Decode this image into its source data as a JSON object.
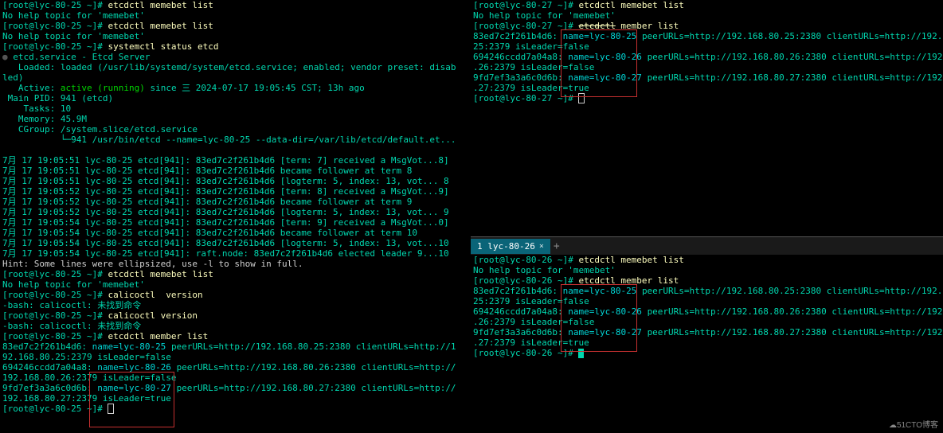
{
  "tabs": {
    "br_label": "1 lyc-80-26"
  },
  "left": {
    "l01_prompt": "[root@lyc-80-25 ~]# ",
    "l01_cmd": "etcdctl memebet list",
    "l02": "No help topic for 'memebet'",
    "l03_prompt": "[root@lyc-80-25 ~]# ",
    "l03_cmd": "etcdctl memebet list",
    "l04": "No help topic for 'memebet'",
    "l05_prompt": "[root@lyc-80-25 ~]# ",
    "l05_cmd": "systemctl status etcd",
    "l06a": "● ",
    "l06b": "etcd.service - Etcd Server",
    "l07": "   Loaded: loaded (/usr/lib/systemd/system/etcd.service; enabled; vendor preset: disab",
    "l07b": "led)",
    "l08a": "   Active: ",
    "l08b": "active (running)",
    "l08c": " since 三 2024-07-17 19:05:45 CST; 13h ago",
    "l09": " Main PID: 941 (etcd)",
    "l10": "    Tasks: 10",
    "l11": "   Memory: 45.9M",
    "l12": "   CGroup: /system.slice/etcd.service",
    "l13": "           └─941 /usr/bin/etcd --name=lyc-80-25 --data-dir=/var/lib/etcd/default.et...",
    "blank1": "",
    "l14": "7月 17 19:05:51 lyc-80-25 etcd[941]: 83ed7c2f261b4d6 [term: 7] received a MsgVot...8]",
    "l15": "7月 17 19:05:51 lyc-80-25 etcd[941]: 83ed7c2f261b4d6 became follower at term 8",
    "l16": "7月 17 19:05:51 lyc-80-25 etcd[941]: 83ed7c2f261b4d6 [logterm: 5, index: 13, vot... 8",
    "l17": "7月 17 19:05:52 lyc-80-25 etcd[941]: 83ed7c2f261b4d6 [term: 8] received a MsgVot...9]",
    "l18": "7月 17 19:05:52 lyc-80-25 etcd[941]: 83ed7c2f261b4d6 became follower at term 9",
    "l19": "7月 17 19:05:52 lyc-80-25 etcd[941]: 83ed7c2f261b4d6 [logterm: 5, index: 13, vot... 9",
    "l20": "7月 17 19:05:54 lyc-80-25 etcd[941]: 83ed7c2f261b4d6 [term: 9] received a MsgVot...0]",
    "l21": "7月 17 19:05:54 lyc-80-25 etcd[941]: 83ed7c2f261b4d6 became follower at term 10",
    "l22": "7月 17 19:05:54 lyc-80-25 etcd[941]: 83ed7c2f261b4d6 [logterm: 5, index: 13, vot...10",
    "l23": "7月 17 19:05:54 lyc-80-25 etcd[941]: raft.node: 83ed7c2f261b4d6 elected leader 9...10",
    "l24": "Hint: Some lines were ellipsized, use -l to show in full.",
    "l25_prompt": "[root@lyc-80-25 ~]# ",
    "l25_cmd": "etcdctl memebet list",
    "l26": "No help topic for 'memebet'",
    "l27_prompt": "[root@lyc-80-25 ~]# ",
    "l27_cmd": "calicoctl  version",
    "l28": "-bash: calicoctl: 未找到命令",
    "l29_prompt": "[root@lyc-80-25 ~]# ",
    "l29_cmd": "calicoctl version",
    "l30": "-bash: calicoctl: 未找到命令",
    "l31_prompt": "[root@lyc-80-25 ~]# ",
    "l31_cmd": "etcdctl member list",
    "l32a": "83ed7c2f261b4d6: ",
    "l32b": "name=lyc-80-25 ",
    "l32c": "peerURLs=http://192.168.80.25:2380 clientURLs=http://1",
    "l33a": "92.168.80.25:2379",
    "l33b": " isLeader=false",
    "l34a": "694246ccdd7a04a8: ",
    "l34b": "name=lyc-80-26 ",
    "l34c": "peerURLs=http://192.168.80.26:2380 clientURLs=http://",
    "l35a": "192.168.80.26:2379 isLeader=false",
    "l36a": "9fd7ef3a3a6c0d6b: ",
    "l36b": "name=lyc-80-27 ",
    "l36c": "peerURLs=http://192.168.80.27:2380 clientURLs=http://",
    "l37": "192.168.80.27:2379 isLeader=true",
    "l38_prompt": "[root@lyc-80-25 ~]# "
  },
  "tr": {
    "l01_prompt": "[root@lyc-80-27 ~]# ",
    "l01_cmd": "etcdctl memebet list",
    "l02": "No help topic for 'memebet'",
    "l03_prompt": "[root@lyc-80-27 ~]# ",
    "l03_cmd1": "etcdctl",
    "l03_cmd2": " member list",
    "l04a": "83ed7c2f261b4d6: ",
    "l04b": "name=lyc-80-25 ",
    "l04c": "peerURLs=http://192.168.80.25:2380 clientURLs=http://192.168.80.",
    "l05": "25:2379 isLeader=false",
    "l06a": "694246ccdd7a04a8: ",
    "l06b": "name=lyc-80-26 ",
    "l06c": "peerURLs=http://192.168.80.26:2380 clientURLs=http://192.168.80",
    "l07": ".26:2379 isLeader=false",
    "l08a": "9fd7ef3a3a6c0d6b: ",
    "l08b": "name=lyc-80-27 ",
    "l08c": "peerURLs=http://192.168.80.27:2380 clientURLs=http://192.168.80",
    "l09": ".27:2379 isLeader=true",
    "l10_prompt": "[root@lyc-80-27 ~]# "
  },
  "br": {
    "l01_prompt": "[root@lyc-80-26 ~]# ",
    "l01_cmd": "etcdctl memebet list",
    "l02": "No help topic for 'memebet'",
    "l03_prompt": "[root@lyc-80-26 ~]# ",
    "l03_cmd1": "etcdctl",
    "l03_cmd2": " member list",
    "l04a": "83ed7c2f261b4d6: ",
    "l04b": "name=lyc-80-25 ",
    "l04c": "peerURLs=http://192.168.80.25:2380 clientURLs=http://192.168.80.",
    "l05": "25:2379 isLeader=false",
    "l06a": "694246ccdd7a04a8: ",
    "l06b": "name=lyc-80-26 ",
    "l06c": "peerURLs=http://192.168.80.26:2380 clientURLs=http://192.168.80",
    "l07": ".26:2379 isLeader=false",
    "l08a": "9fd7ef3a3a6c0d6b: ",
    "l08b": "name=lyc-80-27 ",
    "l08c": "peerURLs=http://192.168.80.27:2380 clientURLs=http://192.168.80",
    "l09": ".27:2379 isLeader=true",
    "l10_prompt": "[root@lyc-80-26 ~]# "
  },
  "watermark": "☁51CTO博客"
}
